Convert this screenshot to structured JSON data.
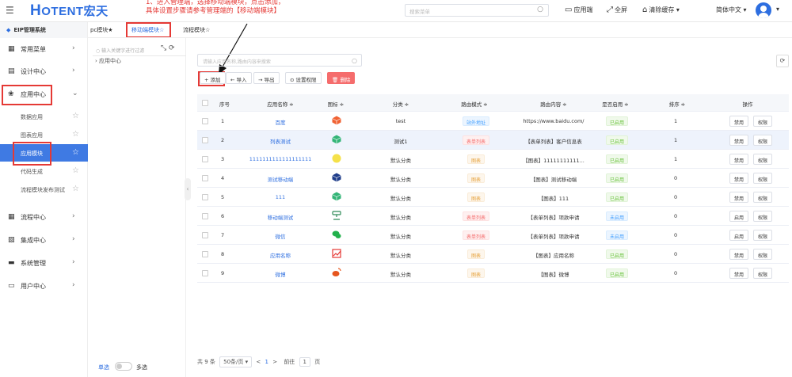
{
  "topbar": {
    "logo_letter": "H",
    "logo_text": "OTENT宏天",
    "annotation_line1": "1、进入管理端，选择移动端模块，点击添加，",
    "annotation_line2": "具体设置步骤请参考管理端的【移动端模块】",
    "search_placeholder": "搜索菜单",
    "app_label": "应用端",
    "fullscreen_label": "全屏",
    "clear_cache_label": "清除缓存",
    "language_label": "简体中文"
  },
  "sidebar": {
    "brand": "EIP管理系统",
    "items": [
      {
        "label": "常用菜单"
      },
      {
        "label": "设计中心"
      },
      {
        "label": "应用中心"
      },
      {
        "label": "流程中心"
      },
      {
        "label": "集成中心"
      },
      {
        "label": "系统管理"
      },
      {
        "label": "用户中心"
      }
    ],
    "sub_items": [
      {
        "label": "数据应用"
      },
      {
        "label": "图表应用"
      },
      {
        "label": "应用模块"
      },
      {
        "label": "代码生成"
      },
      {
        "label": "流程模块发布测试"
      }
    ]
  },
  "tabs": [
    {
      "label": "pc模块★"
    },
    {
      "label": "移动端模块☆"
    },
    {
      "label": "流程模块☆"
    }
  ],
  "tree": {
    "search_placeholder": "输入关键字进行过滤",
    "root": "应用中心",
    "single_label": "单选",
    "multi_label": "多选"
  },
  "main": {
    "search_placeholder": "请输入应用名称,路由内容来搜索",
    "buttons": {
      "add": "+ 添加",
      "import": "← 导入",
      "export": "→ 导出",
      "perm": "设置权限",
      "delete": "删除"
    },
    "headers": [
      "序号",
      "应用名称 ≑",
      "图标 ≑",
      "分类 ≑",
      "路由模式 ≑",
      "路由内容 ≑",
      "是否启用 ≑",
      "排序 ≑",
      "操作"
    ],
    "rows": [
      {
        "no": "1",
        "name": "百度",
        "icon_color": "#f06233",
        "category": "test",
        "mode": "站外地址",
        "mode_style": "blue",
        "content": "https://www.baidu.com/",
        "status": "已启用",
        "status_style": "green",
        "sort": "1",
        "op1": "禁用",
        "op2": "权限"
      },
      {
        "no": "2",
        "name": "列表测试",
        "icon_color": "#33b577",
        "category": "测试1",
        "mode": "表单列表",
        "mode_style": "red",
        "content": "【表单列表】客户信息表",
        "status": "已启用",
        "status_style": "green",
        "sort": "1",
        "op1": "禁用",
        "op2": "权限"
      },
      {
        "no": "3",
        "name": "1111111111111111111",
        "icon_color": "#f5e14a",
        "category": "默认分类",
        "mode": "图表",
        "mode_style": "orange",
        "content": "【图表】11111111111...",
        "status": "已启用",
        "status_style": "green",
        "sort": "1",
        "op1": "禁用",
        "op2": "权限"
      },
      {
        "no": "4",
        "name": "测试移动端",
        "icon_color": "#1f3d8a",
        "category": "默认分类",
        "mode": "图表",
        "mode_style": "orange",
        "content": "【图表】测试移动端",
        "status": "已启用",
        "status_style": "green",
        "sort": "0",
        "op1": "禁用",
        "op2": "权限"
      },
      {
        "no": "5",
        "name": "111",
        "icon_color": "#33b577",
        "category": "默认分类",
        "mode": "图表",
        "mode_style": "orange",
        "content": "【图表】111",
        "status": "已启用",
        "status_style": "green",
        "sort": "0",
        "op1": "禁用",
        "op2": "权限"
      },
      {
        "no": "6",
        "name": "移动端测试",
        "icon_color": "#2e8b57",
        "category": "默认分类",
        "mode": "表单列表",
        "mode_style": "red",
        "content": "【表单列表】项款申请",
        "status": "未启用",
        "status_style": "sblue",
        "sort": "0",
        "op1": "启用",
        "op2": "权限"
      },
      {
        "no": "7",
        "name": "微信",
        "icon_color": "#22b14c",
        "category": "默认分类",
        "mode": "表单列表",
        "mode_style": "red",
        "content": "【表单列表】项款申请",
        "status": "未启用",
        "status_style": "sblue",
        "sort": "0",
        "op1": "启用",
        "op2": "权限"
      },
      {
        "no": "8",
        "name": "应用名称",
        "icon_color": "#e53935",
        "category": "默认分类",
        "mode": "图表",
        "mode_style": "orange",
        "content": "【图表】应用名称",
        "status": "已启用",
        "status_style": "green",
        "sort": "0",
        "op1": "禁用",
        "op2": "权限"
      },
      {
        "no": "9",
        "name": "微博",
        "icon_color": "#e6561e",
        "category": "默认分类",
        "mode": "图表",
        "mode_style": "orange",
        "content": "【图表】微博",
        "status": "已启用",
        "status_style": "green",
        "sort": "0",
        "op1": "禁用",
        "op2": "权限"
      }
    ],
    "pager": {
      "total": "共 9 条",
      "page_size": "50条/页",
      "prev": "<",
      "current": "1",
      "next": ">",
      "goto": "前往",
      "goto_value": "1",
      "page_unit": "页"
    }
  }
}
